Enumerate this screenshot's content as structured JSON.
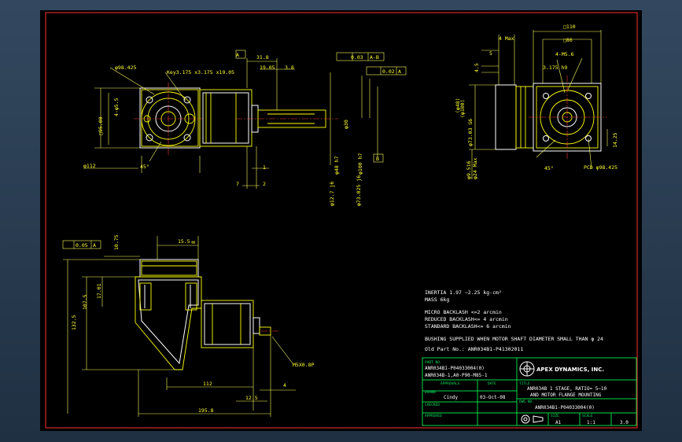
{
  "front_view": {
    "pcd_left": "φ98.425",
    "key": "Key3.175 x3.175 x19.05",
    "bolt_holes": "4-φ5.5",
    "square_left": "□95.00",
    "dia_left": "φ112",
    "angle": "45°",
    "datum_a": "A",
    "datum_b": "B",
    "dim_31_8": "31.8",
    "dim_19_05": "19.05",
    "dim_3_8": "3.8",
    "runout_tol": "0.03",
    "runout_ref": "A-B",
    "flat_tol": "0.02",
    "flat_ref": "A",
    "shaft_dia": "φ30",
    "dim_1": "1",
    "dim_7": "7",
    "dim_2": "2",
    "pilot_1": "φ12.7 j6",
    "pilot_2": "φ73.025 j6",
    "pilot_3": "φ48 h7",
    "pilot_4": "φ100 h7"
  },
  "side_view": {
    "square_top": "□110",
    "square_86": "□86",
    "dim_4_max": "4 Max",
    "bolt": "4-M5.6",
    "dim_5": "5",
    "dim_4_5": "4.5",
    "dim_3_175": "3.175 h9",
    "bolt_circle": "PCD φ98.425",
    "angle": "45°",
    "dim_14_25": "14.25",
    "vert_1": "φ73.03 G6",
    "vert_2": "φ9.516",
    "vert_3": "φ24 Max",
    "vert_4": "(φ48)",
    "vert_5": "(φ100)"
  },
  "bottom_view": {
    "tol": "0.05",
    "tol_ref": "A",
    "dim_10_75": "10.75",
    "dim_15_5": "15.5",
    "dim_8": "8",
    "dim_132_5": "132.5",
    "dim_107_5": "107.5",
    "dim_17_01": "17.01",
    "dim_112": "112",
    "dim_4": "4",
    "dim_12_5": "12.5",
    "dim_195_8": "195.8",
    "thread": "M5X0.8P"
  },
  "notes": [
    "INERTIA    1.97 ~2.25 kg-cm²",
    "MASS  6kg",
    "",
    "MICRO BACKLASH <=2 arcmin",
    "REDUCED BACKLASH<= 4 arcmin",
    "STANDARD BACKLASH<= 6 arcmin",
    "",
    "BUSHING SUPPLIED WHEN MOTOR SHAFT DIAMETER SMALL THAN φ 24",
    "Old Part No.: ANR034B1-P41302011"
  ],
  "title_block": {
    "part_no_label": "PART NO.",
    "part_no_1": "ANR034B1-P04033004(0)",
    "part_no_2": "ANR034B-1,A0-P90-M85-1",
    "company": "APEX DYNAMICS, INC.",
    "approval_label": "APPROVALS",
    "date_label": "DATE",
    "drawn_label": "DRAWN",
    "drawn_by": "Cindy",
    "drawn_date": "03-Oct-08",
    "checked_label": "CHECKED",
    "approved_label": "APPROVED",
    "title_label": "TITLE",
    "title_1": "ANR034B 1 STAGE, RATIO= 5~10",
    "title_2": "AND MOTOR FLANGE MOUNTING",
    "dwg_label": "DWG NO.",
    "dwg_no": "ANR034B1-P04033004(0)",
    "size_label": "SIZE",
    "size": "A1",
    "scale_label": "SCALE",
    "scale": "1:1",
    "rev": "3.0"
  },
  "colors": {
    "sheet": "#000000",
    "border": "#ff3030",
    "lines": "#ffff00",
    "title_block": "#00d84a"
  }
}
